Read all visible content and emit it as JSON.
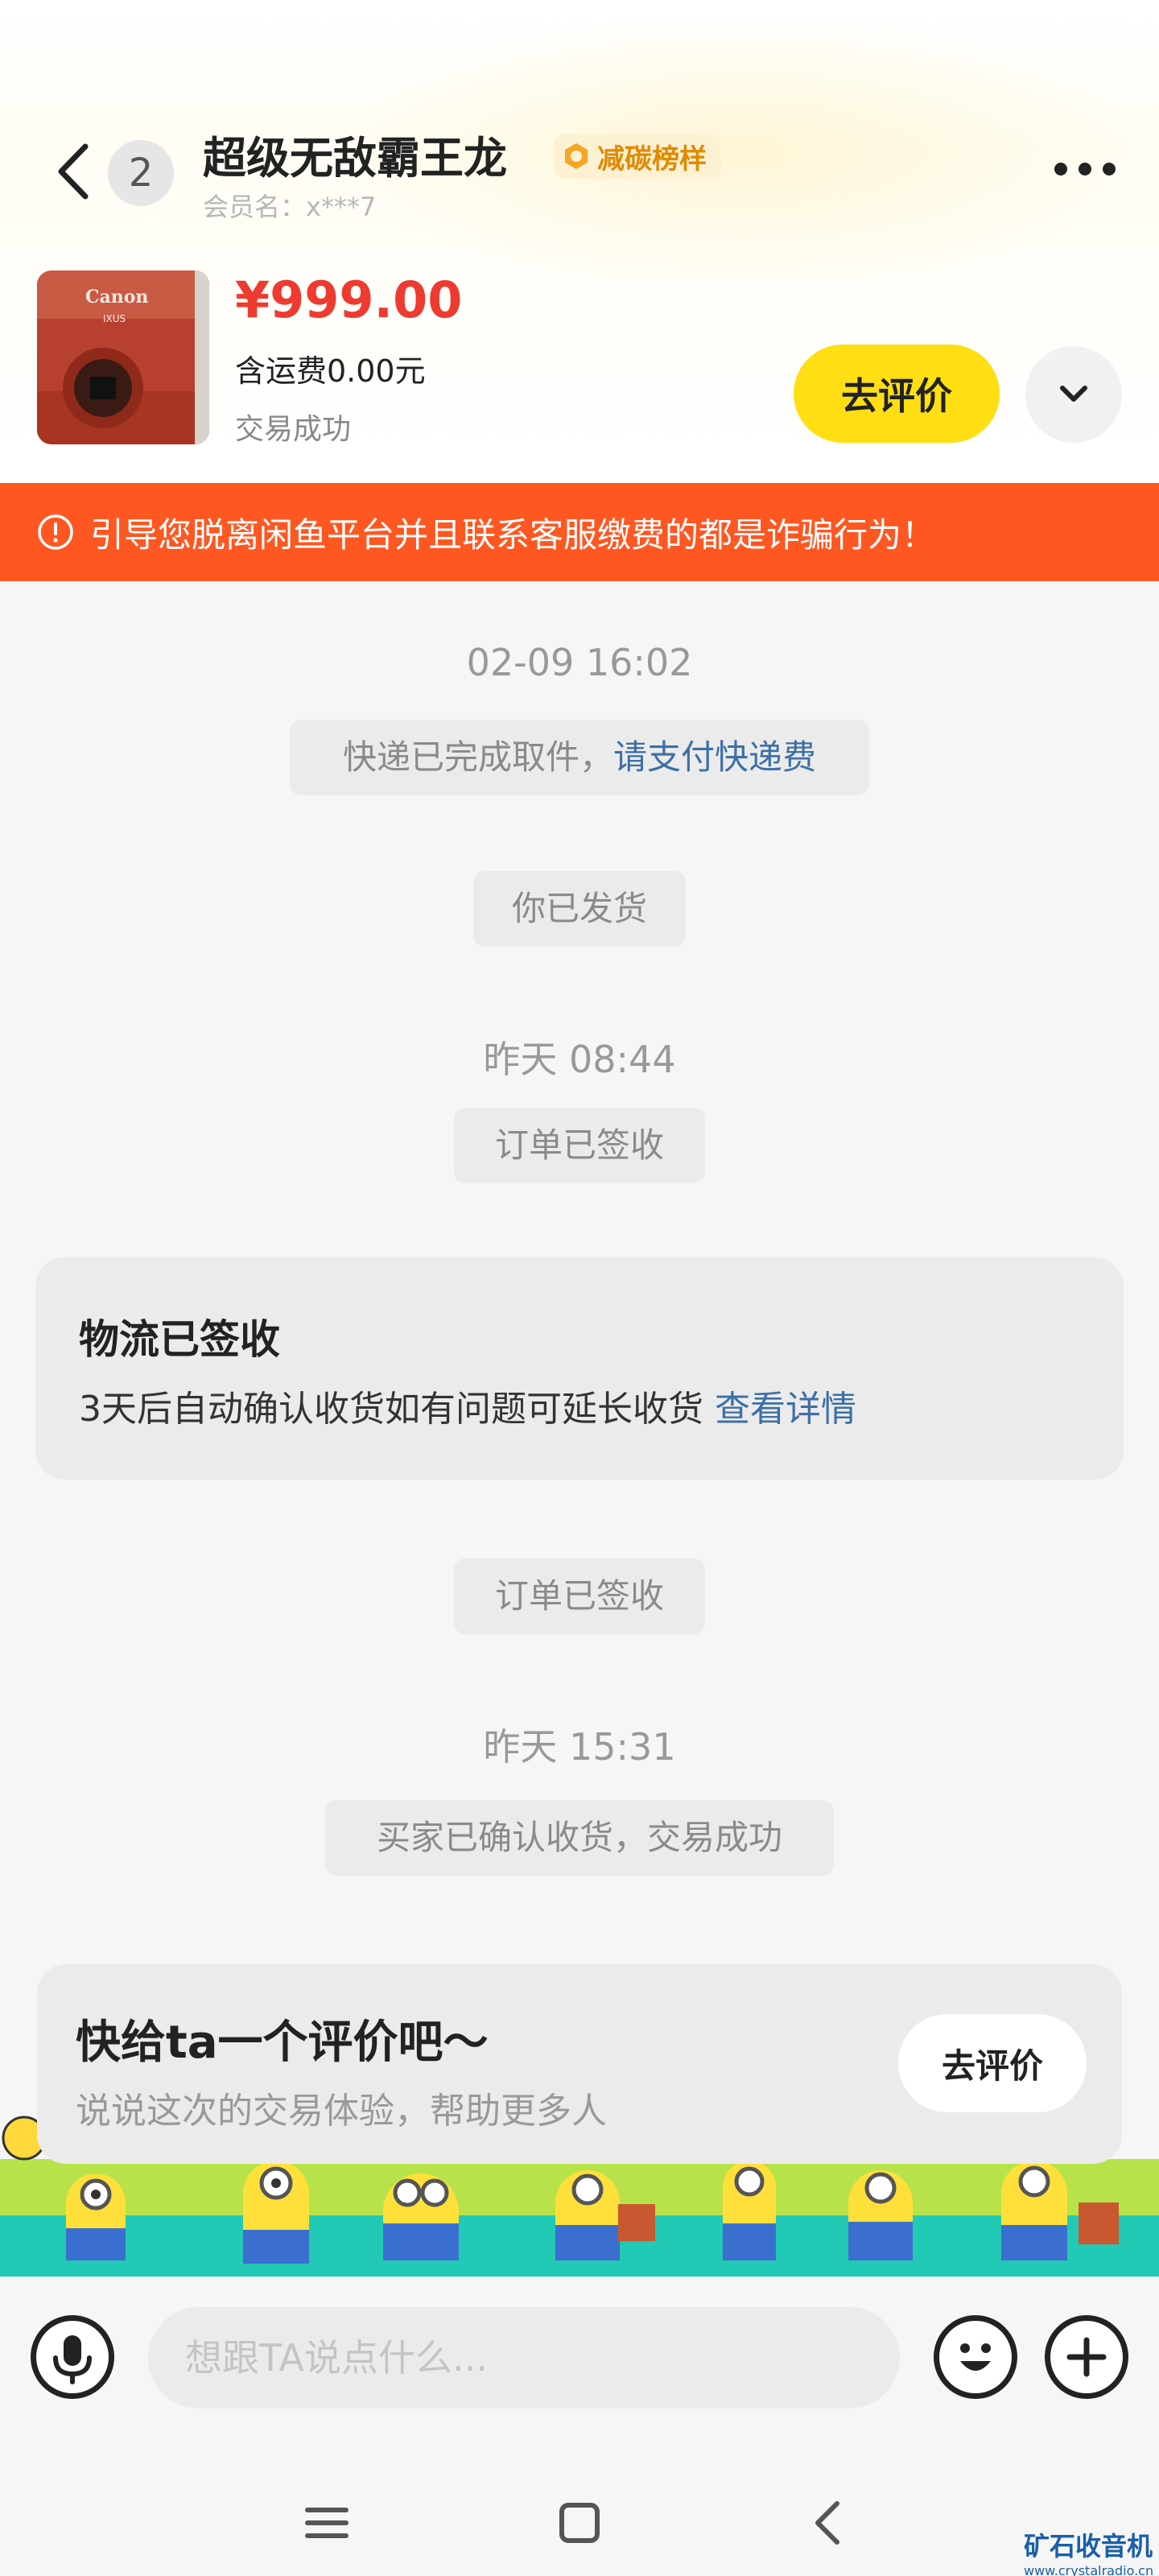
{
  "header": {
    "unread_count": "2",
    "seller_name": "超级无敌霸王龙",
    "carbon_badge": "减碳榜样",
    "member_label": "会员名：x***7"
  },
  "product": {
    "price": "¥999.00",
    "shipping": "含运费0.00元",
    "status": "交易成功",
    "review_button": "去评价"
  },
  "warning": {
    "text": "引导您脱离闲鱼平台并且联系客服缴费的都是诈骗行为！"
  },
  "chat": {
    "time1": "02-09 16:02",
    "msg_pickup_prefix": "快递已完成取件，",
    "msg_pickup_link": "请支付快递费",
    "msg_shipped": "你已发货",
    "time2": "昨天 08:44",
    "msg_signed_1": "订单已签收",
    "logistics_title": "物流已签收",
    "logistics_desc": "3天后自动确认收货如有问题可延长收货",
    "logistics_link": "查看详情",
    "msg_signed_2": "订单已签收",
    "time3": "昨天 15:31",
    "msg_confirmed": "买家已确认收货，交易成功"
  },
  "review_card": {
    "title": "快给ta一个评价吧～",
    "subtitle": "说说这次的交易体验，帮助更多人",
    "button": "去评价"
  },
  "input": {
    "placeholder": "想跟TA说点什么..."
  },
  "watermark": {
    "name": "矿石收音机",
    "url": "www.crystalradio.cn"
  },
  "colors": {
    "accent_yellow": "#ffdf14",
    "price_red": "#ee3a30",
    "warning_orange": "#ff5722",
    "link_blue": "#3d6fa6"
  }
}
